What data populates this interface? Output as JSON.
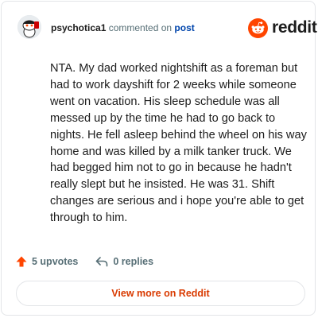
{
  "comment": {
    "author": "psychotica1",
    "action_text": " commented on ",
    "post_link_label": "post",
    "body": "NTA. My dad worked nightshift as a foreman but had to work dayshift for 2 weeks while someone went on vacation. His sleep schedule was all messed up by the time he had to go back to nights. He fell asleep behind the wheel on his way home and was killed by a milk tanker truck. We had begged him not to go in because he hadn't really slept but he insisted. He was 31. Shift changes are serious and i hope you're able to get through to him.",
    "upvotes_label": "5 upvotes",
    "replies_label": "0 replies"
  },
  "brand": {
    "wordmark": "reddit",
    "accent_color": "#ff4500"
  },
  "footer": {
    "view_more_label": "View more on Reddit"
  },
  "icons": {
    "logo": "reddit-alien-logo",
    "upvote": "upvote-arrow-icon",
    "reply": "reply-arrow-icon",
    "avatar": "snoo-avatar"
  }
}
